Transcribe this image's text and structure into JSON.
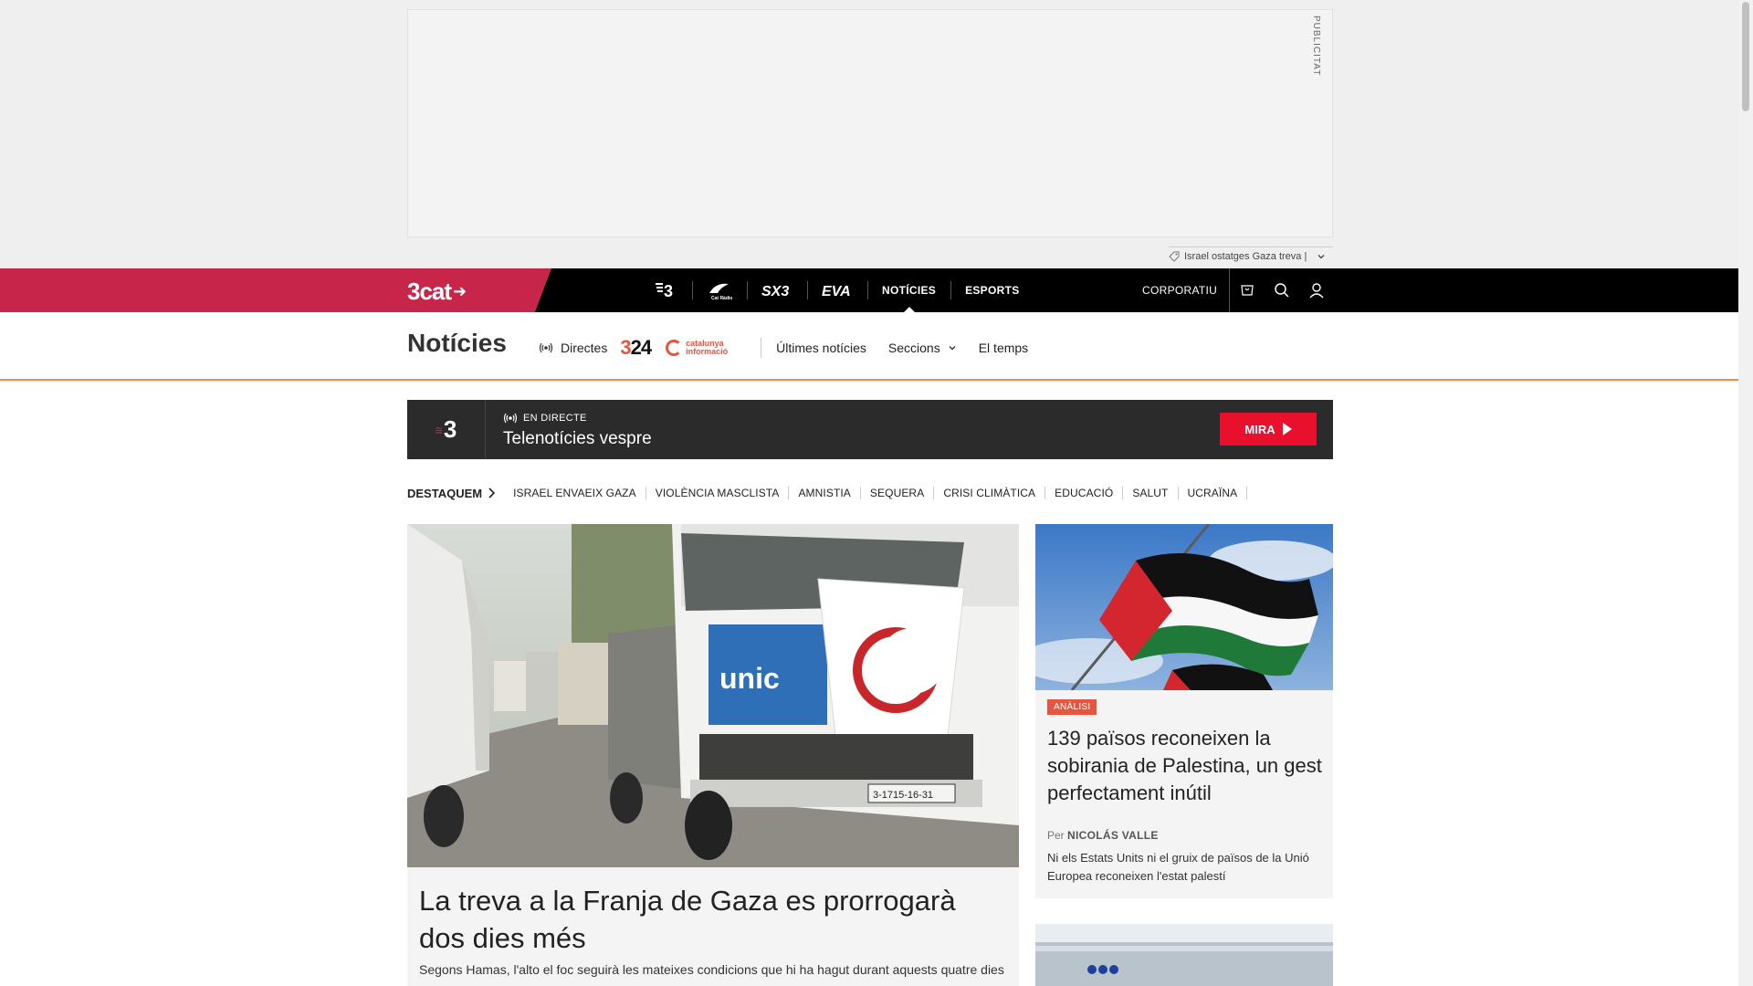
{
  "ad": {
    "label": "PUBLICITAT"
  },
  "tag_strip": {
    "text": "Israel ostatges Gaza treva |"
  },
  "topbar": {
    "brand": "3cat",
    "channels": [
      {
        "label": "3",
        "icon": "tv3-logo"
      },
      {
        "label": "Cat Ràdio",
        "icon": "catradio-logo"
      },
      {
        "label": "SX3",
        "icon": "sx3-logo"
      },
      {
        "label": "EVA",
        "icon": "eva-logo"
      },
      {
        "label": "NOTÍCIES",
        "active": true
      },
      {
        "label": "ESPORTS"
      }
    ],
    "corporate": "CORPORATIU"
  },
  "subnav": {
    "title": "Notícies",
    "directes": "Directes",
    "logo_324": "324",
    "logo_ci": "catalunya informació",
    "links": [
      "Últimes notícies",
      "Seccions",
      "El temps"
    ]
  },
  "live": {
    "channel": "3",
    "tag": "EN DIRECTE",
    "title": "Telenotícies vespre",
    "button": "MIRA"
  },
  "destaquem": {
    "label": "DESTAQUEM",
    "tags": [
      "ISRAEL ENVAEIX GAZA",
      "VIOLÈNCIA MASCLISTA",
      "AMNISTIA",
      "SEQUERA",
      "CRISI CLIMÀTICA",
      "EDUCACIÓ",
      "SALUT",
      "UCRAÏNA"
    ]
  },
  "main_article": {
    "title": "La treva a la Franja de Gaza es prorrogarà dos dies més",
    "summary": "Segons Hamas, l'alto el foc seguirà les mateixes condicions que hi ha hagut durant aquests quatre dies",
    "image_text": {
      "truck_plate": "3-1715-16-31",
      "sign": "unic"
    }
  },
  "side_article": {
    "badge": "ANÀLISI",
    "title": "139 països reconeixen la sobirania de Palestina, un gest perfectament inútil",
    "byline_prefix": "Per",
    "author": "NICOLÁS VALLE",
    "summary": "Ni els Estats Units ni el gruix de països de la Unió Europea reconeixen l'estat palestí"
  },
  "colors": {
    "brand": "#c8254b",
    "accent": "#e8553e",
    "live_button": "#e8102d",
    "topbar": "#000000"
  }
}
